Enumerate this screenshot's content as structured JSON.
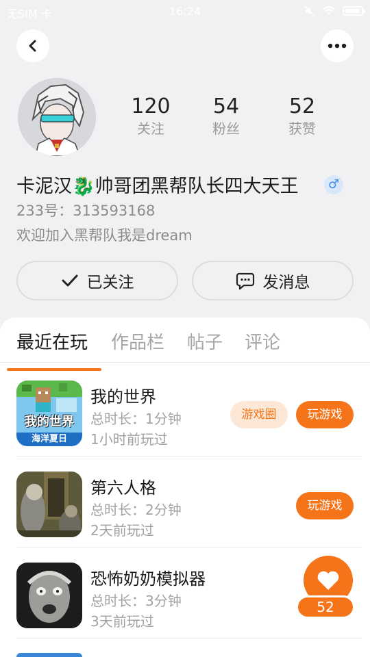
{
  "status_bar": {
    "carrier": "无SIM 卡",
    "time": "16:24"
  },
  "profile": {
    "stats": [
      {
        "value": "120",
        "label": "关注"
      },
      {
        "value": "54",
        "label": "粉丝"
      },
      {
        "value": "52",
        "label": "获赞"
      }
    ],
    "name": "卡泥汉🐉帅哥团黑帮队长四大天王",
    "gender": "♂",
    "id_line": "233号：313593168",
    "bio": "欢迎加入黑帮队我是dream"
  },
  "actions": {
    "follow_label": "已关注",
    "message_label": "发消息"
  },
  "tabs": [
    {
      "label": "最近在玩"
    },
    {
      "label": "作品栏"
    },
    {
      "label": "帖子"
    },
    {
      "label": "评论"
    }
  ],
  "games": [
    {
      "title": "我的世界",
      "duration": "总时长：1分钟",
      "last_played": "1小时前玩过",
      "icon_text": "我的世界",
      "icon_sub": "海洋夏日",
      "circle_label": "游戏圈",
      "play_label": "玩游戏"
    },
    {
      "title": "第六人格",
      "duration": "总时长：2分钟",
      "last_played": "2天前玩过",
      "play_label": "玩游戏"
    },
    {
      "title": "恐怖奶奶模拟器",
      "duration": "总时长：3分钟",
      "last_played": "3天前玩过"
    }
  ],
  "like_count": "52",
  "colors": {
    "accent": "#f5741a",
    "accent_light": "#fde8d8",
    "background": "#f1f1f3"
  }
}
